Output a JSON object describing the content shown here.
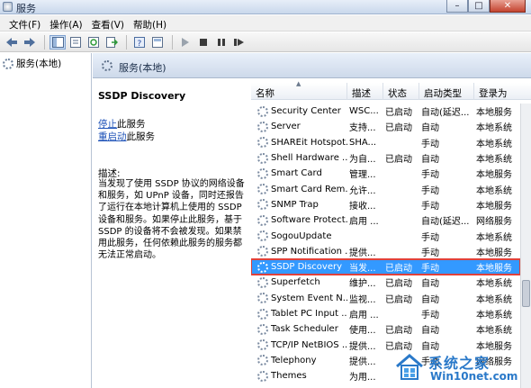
{
  "window": {
    "title": "服务"
  },
  "menu": [
    {
      "label": "文件(F)"
    },
    {
      "label": "操作(A)"
    },
    {
      "label": "查看(V)"
    },
    {
      "label": "帮助(H)"
    }
  ],
  "tree": {
    "item": "服务(本地)"
  },
  "header": {
    "title": "服务(本地)"
  },
  "details": {
    "service_name": "SSDP Discovery",
    "stop_link": "停止",
    "stop_suffix": "此服务",
    "restart_link": "重启动",
    "restart_suffix": "此服务",
    "desc_label": "描述:",
    "desc_text": "当发现了使用 SSDP 协议的网络设备和服务，如 UPnP 设备，同时还报告了运行在本地计算机上使用的 SSDP 设备和服务。如果停止此服务，基于 SSDP 的设备将不会被发现。如果禁用此服务，任何依赖此服务的服务都无法正常启动。"
  },
  "columns": [
    "名称",
    "描述",
    "状态",
    "启动类型",
    "登录为"
  ],
  "services": [
    {
      "name": "Security Center",
      "desc": "WSC...",
      "status": "已启动",
      "startup": "自动(延迟...",
      "logon": "本地服务"
    },
    {
      "name": "Server",
      "desc": "支持...",
      "status": "已启动",
      "startup": "自动",
      "logon": "本地系统"
    },
    {
      "name": "SHAREit Hotspot...",
      "desc": "SHA...",
      "status": "",
      "startup": "手动",
      "logon": "本地系统"
    },
    {
      "name": "Shell Hardware ...",
      "desc": "为自...",
      "status": "已启动",
      "startup": "自动",
      "logon": "本地系统"
    },
    {
      "name": "Smart Card",
      "desc": "管理...",
      "status": "",
      "startup": "手动",
      "logon": "本地服务"
    },
    {
      "name": "Smart Card Rem...",
      "desc": "允许...",
      "status": "",
      "startup": "手动",
      "logon": "本地系统"
    },
    {
      "name": "SNMP Trap",
      "desc": "接收...",
      "status": "",
      "startup": "手动",
      "logon": "本地服务"
    },
    {
      "name": "Software Protect...",
      "desc": "启用 ...",
      "status": "",
      "startup": "自动(延迟...",
      "logon": "网络服务"
    },
    {
      "name": "SogouUpdate",
      "desc": "",
      "status": "",
      "startup": "手动",
      "logon": "本地系统"
    },
    {
      "name": "SPP Notification ...",
      "desc": "提供...",
      "status": "",
      "startup": "手动",
      "logon": "本地服务"
    },
    {
      "name": "SSDP Discovery",
      "desc": "当发...",
      "status": "已启动",
      "startup": "手动",
      "logon": "本地服务",
      "selected": true
    },
    {
      "name": "Superfetch",
      "desc": "维护...",
      "status": "已启动",
      "startup": "自动",
      "logon": "本地系统"
    },
    {
      "name": "System Event N...",
      "desc": "监视...",
      "status": "已启动",
      "startup": "自动",
      "logon": "本地系统"
    },
    {
      "name": "Tablet PC Input ...",
      "desc": "启用 ...",
      "status": "",
      "startup": "手动",
      "logon": "本地系统"
    },
    {
      "name": "Task Scheduler",
      "desc": "使用...",
      "status": "已启动",
      "startup": "自动",
      "logon": "本地系统"
    },
    {
      "name": "TCP/IP NetBIOS ...",
      "desc": "提供...",
      "status": "已启动",
      "startup": "自动",
      "logon": "本地服务"
    },
    {
      "name": "Telephony",
      "desc": "提供...",
      "status": "",
      "startup": "手动",
      "logon": "网络服务"
    },
    {
      "name": "Themes",
      "desc": "为用...",
      "status": "",
      "startup": "",
      "logon": ""
    }
  ],
  "watermark": {
    "line1": "系统之家",
    "line2": "Win10net.com"
  },
  "colors": {
    "selection": "#3399ff",
    "highlight_border": "#e0413a",
    "link": "#1f53b8"
  },
  "icons": [
    "back-icon",
    "forward-icon",
    "console-tree-icon",
    "properties-icon",
    "refresh-icon",
    "export-icon",
    "help-icon",
    "play-icon",
    "stop-icon",
    "pause-icon",
    "restart-icon",
    "gear-icon"
  ]
}
